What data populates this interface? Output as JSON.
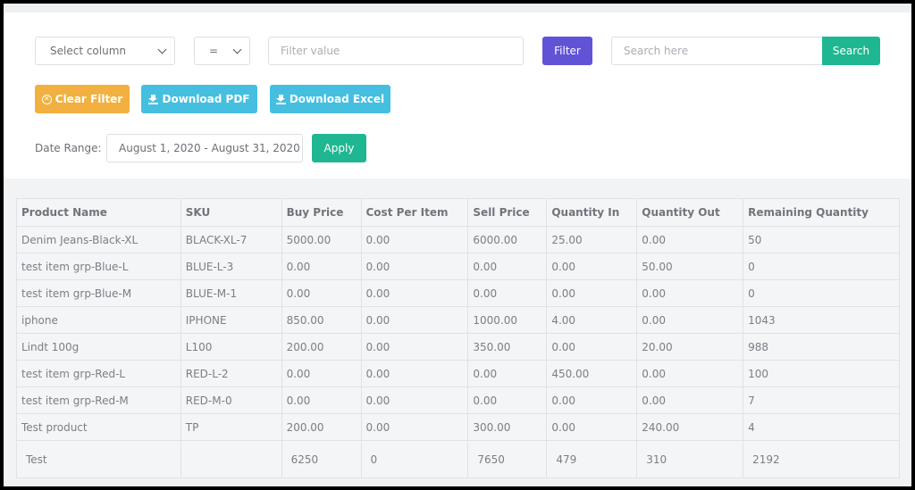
{
  "filter_bar": {
    "column_select": {
      "selected": "Select column"
    },
    "operator_select": {
      "selected": "="
    },
    "filter_value": {
      "value": "",
      "placeholder": "Filter value"
    },
    "filter_button": "Filter",
    "search": {
      "value": "",
      "placeholder": "Search here"
    },
    "search_button": "Search"
  },
  "actions": {
    "clear_filter": "Clear Filter",
    "download_pdf": "Download PDF",
    "download_excel": "Download Excel"
  },
  "date_range": {
    "label": "Date Range:",
    "value": "August 1, 2020 - August 31, 2020",
    "apply_button": "Apply"
  },
  "colors": {
    "filter": "#6153d6",
    "search": "#1fb791",
    "clear": "#f1b040",
    "download": "#44bfe0",
    "apply": "#1fb791"
  },
  "table": {
    "headers": [
      "Product Name",
      "SKU",
      "Buy Price",
      "Cost Per Item",
      "Sell Price",
      "Quantity In",
      "Quantity Out",
      "Remaining Quantity"
    ],
    "rows": [
      [
        "Denim Jeans-Black-XL",
        "BLACK-XL-7",
        "5000.00",
        "0.00",
        "6000.00",
        "25.00",
        "0.00",
        "50"
      ],
      [
        "test item grp-Blue-L",
        "BLUE-L-3",
        "0.00",
        "0.00",
        "0.00",
        "0.00",
        "50.00",
        "0"
      ],
      [
        "test item grp-Blue-M",
        "BLUE-M-1",
        "0.00",
        "0.00",
        "0.00",
        "0.00",
        "0.00",
        "0"
      ],
      [
        "iphone",
        "IPHONE",
        "850.00",
        "0.00",
        "1000.00",
        "4.00",
        "0.00",
        "1043"
      ],
      [
        "Lindt 100g",
        "L100",
        "200.00",
        "0.00",
        "350.00",
        "0.00",
        "20.00",
        "988"
      ],
      [
        "test item grp-Red-L",
        "RED-L-2",
        "0.00",
        "0.00",
        "0.00",
        "450.00",
        "0.00",
        "100"
      ],
      [
        "test item grp-Red-M",
        "RED-M-0",
        "0.00",
        "0.00",
        "0.00",
        "0.00",
        "0.00",
        "7"
      ],
      [
        "Test product",
        "TP",
        "200.00",
        "0.00",
        "300.00",
        "0.00",
        "240.00",
        "4"
      ]
    ],
    "total_row": [
      "Test",
      "",
      "6250",
      "0",
      "7650",
      "479",
      "310",
      "2192"
    ]
  }
}
